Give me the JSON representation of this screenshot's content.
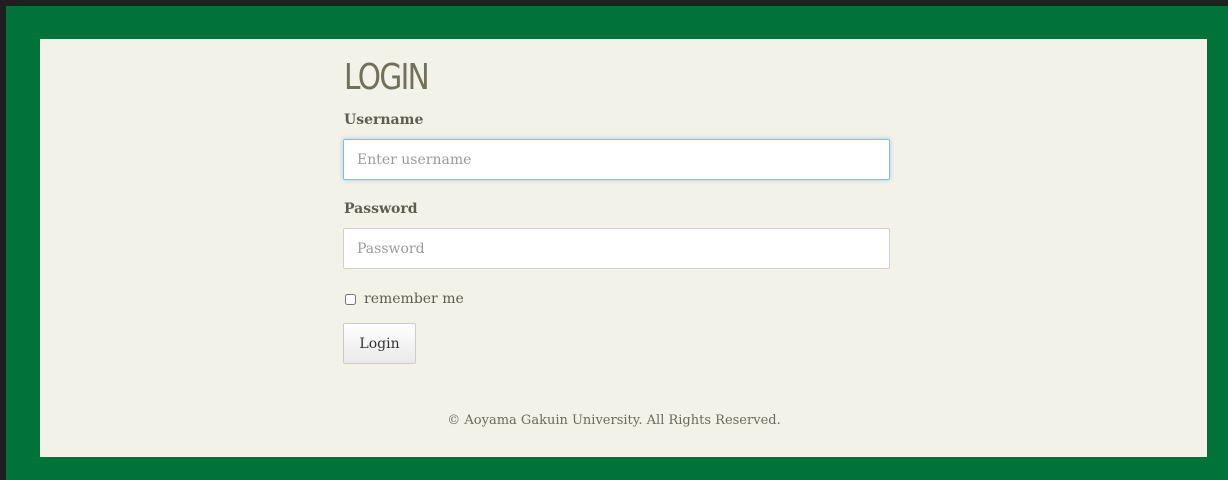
{
  "login": {
    "title": "LOGIN",
    "username_label": "Username",
    "username_placeholder": "Enter username",
    "username_value": "",
    "password_label": "Password",
    "password_placeholder": "Password",
    "password_value": "",
    "remember_label": "remember me",
    "remember_checked": false,
    "submit_label": "Login"
  },
  "footer": {
    "copyright": "© Aoyama Gakuin University. All Rights Reserved."
  },
  "colors": {
    "frame": "#00723a",
    "panel": "#f2f2e8",
    "title": "#72705d",
    "focus_border": "#85bde0"
  }
}
